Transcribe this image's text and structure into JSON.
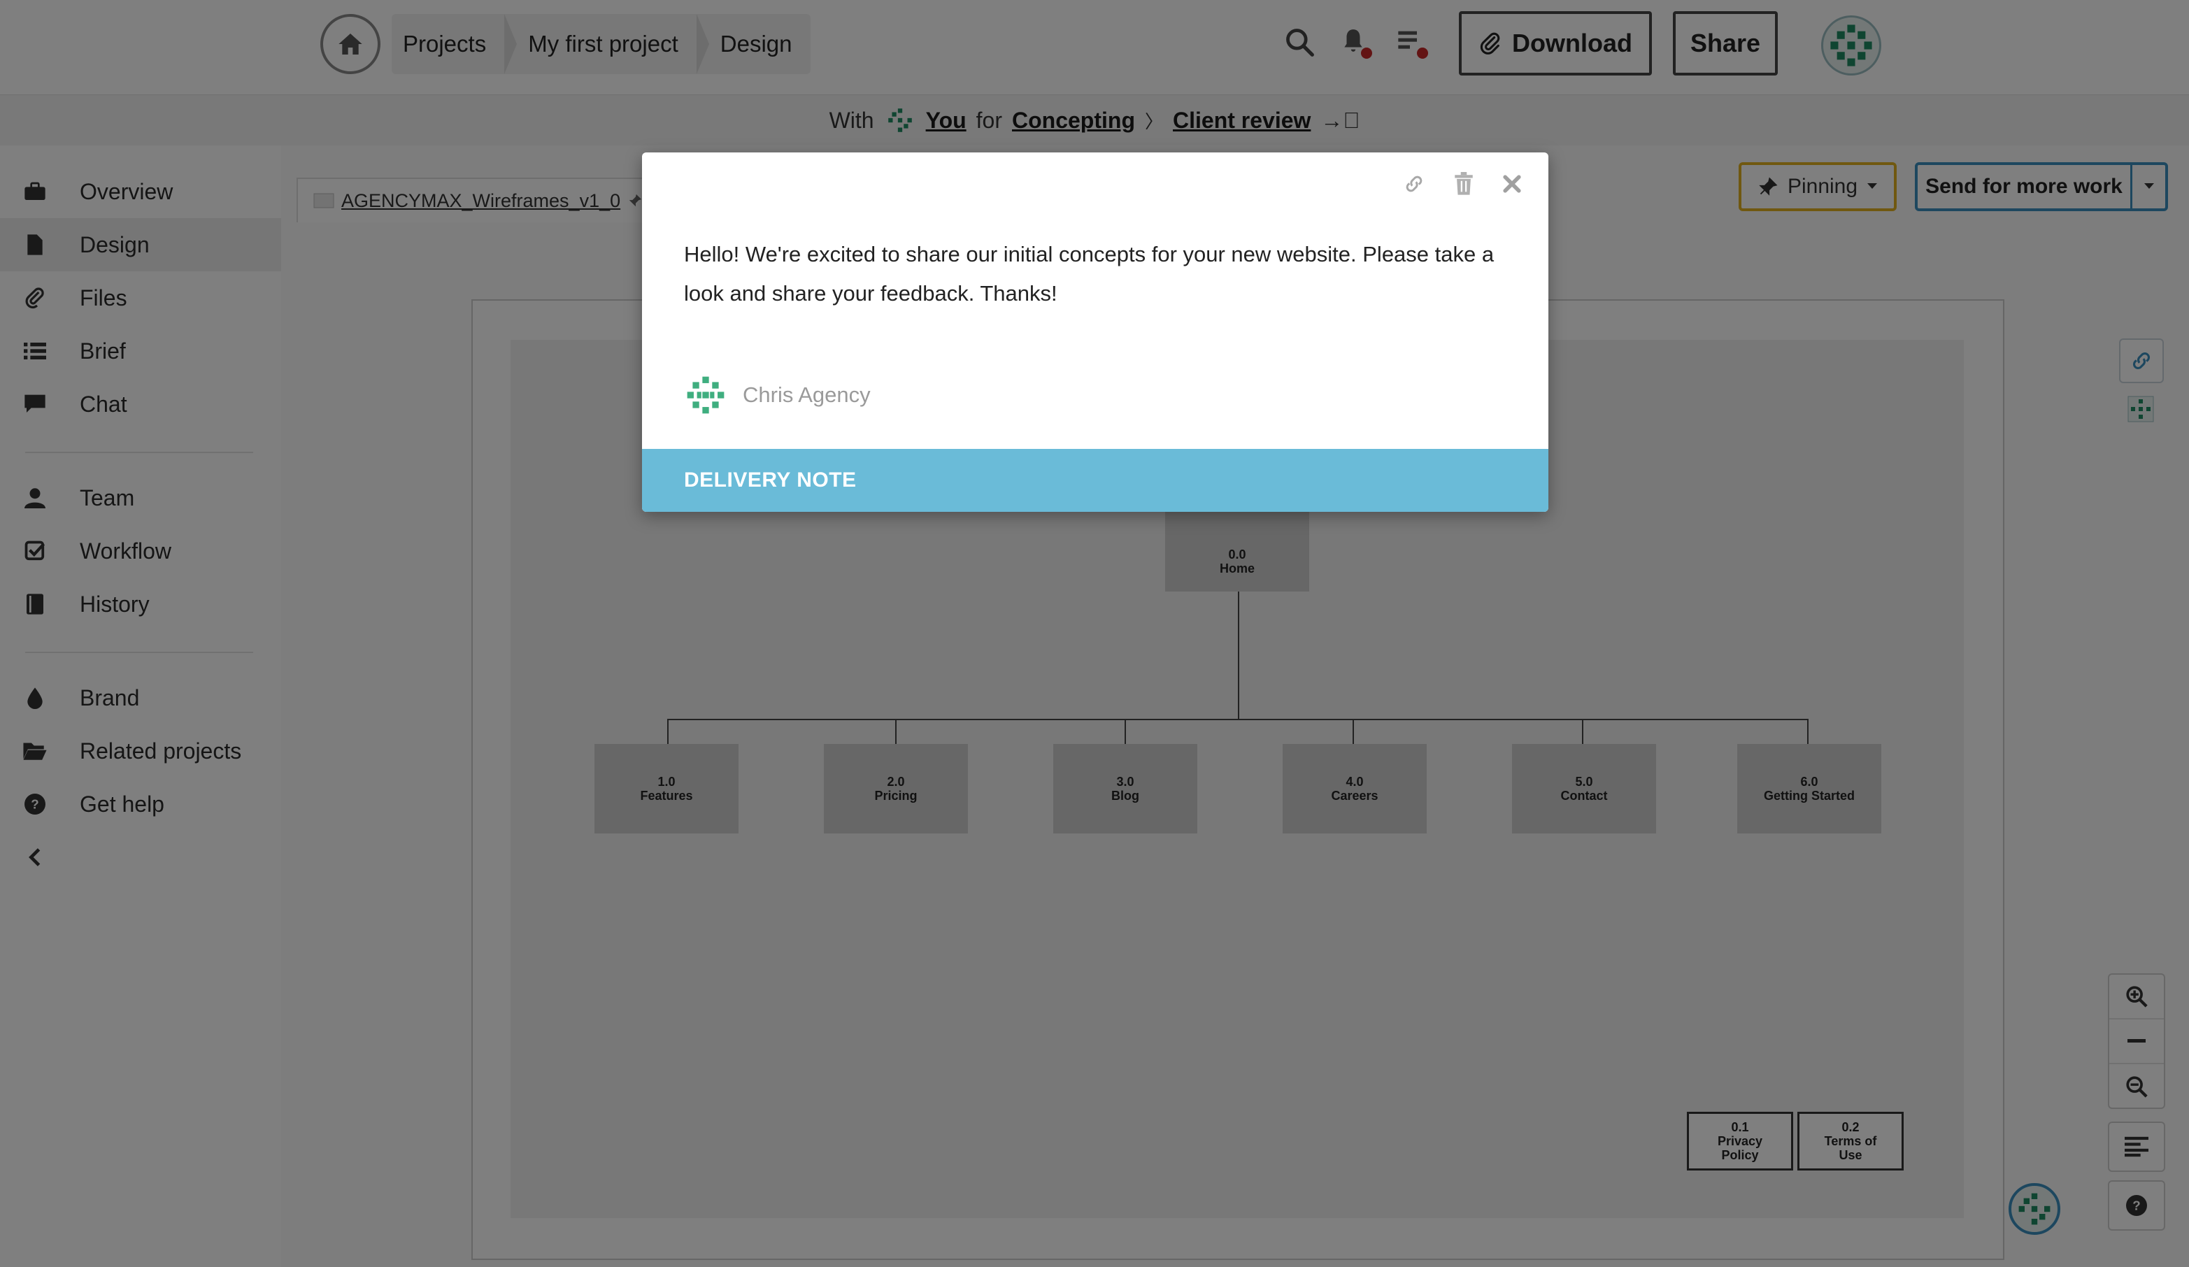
{
  "topbar": {
    "breadcrumbs": [
      "Projects",
      "My first project",
      "Design"
    ],
    "download_label": "Download",
    "share_label": "Share"
  },
  "status": {
    "with": "With",
    "user": "You",
    "for": "for",
    "stage": "Concepting",
    "sep": "〉",
    "step": "Client review",
    "arrow": "→⃒"
  },
  "sidebar": {
    "items": [
      {
        "label": "Overview",
        "icon": "briefcase-icon"
      },
      {
        "label": "Design",
        "icon": "file-icon"
      },
      {
        "label": "Files",
        "icon": "paperclip-icon"
      },
      {
        "label": "Brief",
        "icon": "list-icon"
      },
      {
        "label": "Chat",
        "icon": "chat-icon"
      },
      {
        "label": "Team",
        "icon": "user-icon"
      },
      {
        "label": "Workflow",
        "icon": "checkbox-icon"
      },
      {
        "label": "History",
        "icon": "book-icon"
      },
      {
        "label": "Brand",
        "icon": "drop-icon"
      },
      {
        "label": "Related projects",
        "icon": "folder-icon"
      },
      {
        "label": "Get help",
        "icon": "help-icon"
      }
    ],
    "active": "Design"
  },
  "workspace": {
    "file_tab": "AGENCYMAX_Wireframes_v1_0",
    "pinning_label": "Pinning",
    "send_label": "Send for more work"
  },
  "sitemap": {
    "root": {
      "num": "0.0",
      "name": "Home"
    },
    "children": [
      {
        "num": "1.0",
        "name": "Features"
      },
      {
        "num": "2.0",
        "name": "Pricing"
      },
      {
        "num": "3.0",
        "name": "Blog"
      },
      {
        "num": "4.0",
        "name": "Careers"
      },
      {
        "num": "5.0",
        "name": "Contact"
      },
      {
        "num": "6.0",
        "name": "Getting Started"
      }
    ],
    "footer": [
      {
        "num": "0.1",
        "name": "Privacy Policy"
      },
      {
        "num": "0.2",
        "name": "Terms of Use"
      }
    ]
  },
  "modal": {
    "message": "Hello! We're excited to share our initial concepts for your new website. Please take a look and share your feedback. Thanks!",
    "author": "Chris Agency",
    "footer_label": "DELIVERY NOTE"
  },
  "colors": {
    "accent": "#6abbd8",
    "pinning_border": "#e0b020",
    "send_border": "#3a8fbf",
    "notification_dot": "#c62828"
  }
}
